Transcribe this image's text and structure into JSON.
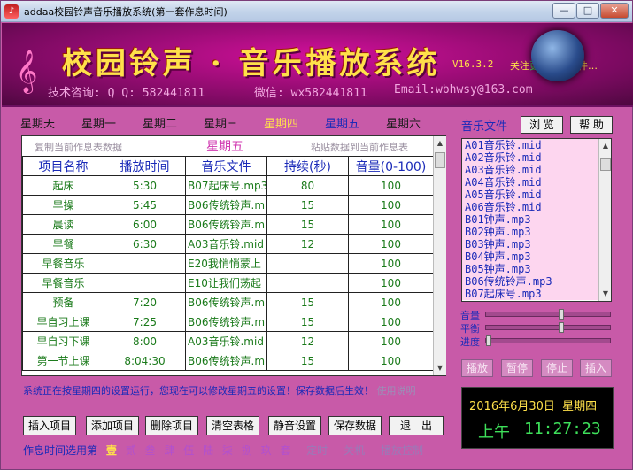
{
  "window": {
    "title": "addaa校园铃声音乐播放系统(第一套作息时间)",
    "min": "—",
    "max": "□",
    "close": "✕"
  },
  "banner": {
    "title": "校园铃声 · 音乐播放系统",
    "version": "V16.3.2",
    "marquee_yellow": "关注",
    "marquee_green": "更多的",
    "marquee_tail": "空软件…",
    "contact_tech": "技术咨询: Q Q: 582441811",
    "contact_wechat": "微信: wx582441811",
    "contact_email": "Email:wbhwsy@163.com"
  },
  "days": [
    "星期天",
    "星期一",
    "星期二",
    "星期三",
    "星期四",
    "星期五",
    "星期六"
  ],
  "schedule": {
    "copy_label": "复制当前作息表数据",
    "current_day": "星期五",
    "paste_label": "粘贴数据到当前作息表",
    "headers": [
      "项目名称",
      "播放时间",
      "音乐文件",
      "持续(秒)",
      "音量(0-100)"
    ],
    "rows": [
      [
        "起床",
        "5:30",
        "B07起床号.mp3",
        "80",
        "100"
      ],
      [
        "早操",
        "5:45",
        "B06传统铃声.m",
        "15",
        "100"
      ],
      [
        "晨读",
        "6:00",
        "B06传统铃声.m",
        "15",
        "100"
      ],
      [
        "早餐",
        "6:30",
        "A03音乐铃.mid",
        "12",
        "100"
      ],
      [
        "早餐音乐",
        "",
        "E20我悄悄蒙上",
        "",
        "100"
      ],
      [
        "早餐音乐",
        "",
        "E10让我们荡起",
        "",
        "100"
      ],
      [
        "预备",
        "7:20",
        "B06传统铃声.m",
        "15",
        "100"
      ],
      [
        "早自习上课",
        "7:25",
        "B06传统铃声.m",
        "15",
        "100"
      ],
      [
        "早自习下课",
        "8:00",
        "A03音乐铃.mid",
        "12",
        "100"
      ],
      [
        "第一节上课",
        "8:04:30",
        "B06传统铃声.m",
        "15",
        "100"
      ]
    ]
  },
  "status": {
    "message": "系统正在按星期四的设置运行，您现在可以修改星期五的设置！保存数据后生效！",
    "save_hint": "使用说明"
  },
  "actions": [
    "插入项目",
    "添加项目",
    "删除项目",
    "清空表格",
    "静音设置",
    "保存数据",
    "退　出"
  ],
  "bottom": {
    "label": "作息时间选用第",
    "sets": [
      "壹",
      "贰",
      "叁",
      "肆",
      "伍",
      "陆",
      "柒",
      "捌",
      "玖",
      "套"
    ],
    "extra1": "定时",
    "extra2": "关机",
    "extra3": "播放控制"
  },
  "music": {
    "label": "音乐文件",
    "browse": "浏 览",
    "help": "帮 助",
    "files": [
      "A01音乐铃.mid",
      "A02音乐铃.mid",
      "A03音乐铃.mid",
      "A04音乐铃.mid",
      "A05音乐铃.mid",
      "A06音乐铃.mid",
      "B01钟声.mp3",
      "B02钟声.mp3",
      "B03钟声.mp3",
      "B04钟声.mp3",
      "B05钟声.mp3",
      "B06传统铃声.mp3",
      "B07起床号.mp3"
    ]
  },
  "sliders": [
    {
      "label": "音量",
      "value": 0.6
    },
    {
      "label": "平衡",
      "value": 0.6
    },
    {
      "label": "进度",
      "value": 0.0
    }
  ],
  "player": [
    "播放",
    "暂停",
    "停止",
    "插入"
  ],
  "clock": {
    "date": "2016年6月30日",
    "weekday": "星期四",
    "ampm": "上午",
    "time": "11:27:23"
  }
}
